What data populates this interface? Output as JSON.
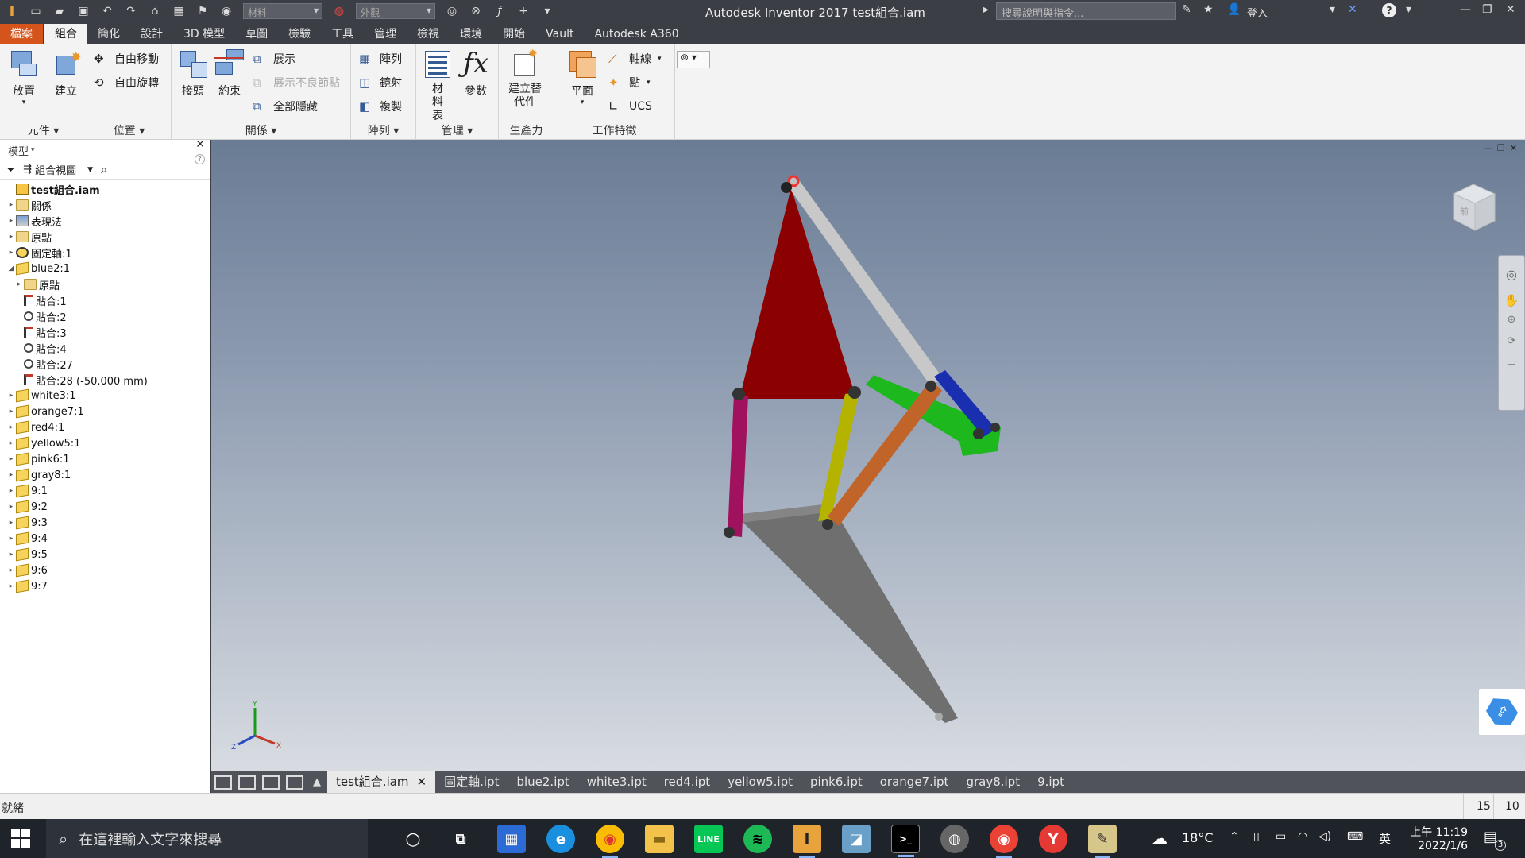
{
  "titlebar": {
    "app_title": "Autodesk Inventor 2017    test組合.iam",
    "material_placeholder": "材料",
    "appearance_placeholder": "外觀",
    "search_placeholder": "搜尋說明與指令...",
    "signin_label": "登入",
    "help_label": "?"
  },
  "ribbon_tabs": [
    {
      "label": "檔案"
    },
    {
      "label": "組合"
    },
    {
      "label": "簡化"
    },
    {
      "label": "設計"
    },
    {
      "label": "3D 模型"
    },
    {
      "label": "草圖"
    },
    {
      "label": "檢驗"
    },
    {
      "label": "工具"
    },
    {
      "label": "管理"
    },
    {
      "label": "檢視"
    },
    {
      "label": "環境"
    },
    {
      "label": "開始"
    },
    {
      "label": "Vault"
    },
    {
      "label": "Autodesk A360"
    }
  ],
  "ribbon": {
    "component": {
      "label": "元件",
      "place": "放置",
      "create": "建立"
    },
    "position": {
      "label": "位置",
      "free_move": "自由移動",
      "free_rotate": "自由旋轉"
    },
    "relationships": {
      "label": "關係",
      "joint": "接頭",
      "constrain": "約束",
      "show": "展示",
      "show_sick": "展示不良節點",
      "hide_all": "全部隱藏"
    },
    "pattern": {
      "label": "陣列",
      "pattern": "陣列",
      "mirror": "鏡射",
      "copy": "複製"
    },
    "manage": {
      "label": "管理",
      "bom": "材料表",
      "params": "參數"
    },
    "productivity": {
      "label": "生產力",
      "substitute": "建立替代件"
    },
    "work_features": {
      "label": "工作特徵",
      "plane": "平面",
      "axis": "軸線",
      "point": "點",
      "ucs": "UCS"
    }
  },
  "browser": {
    "title": "模型",
    "view_label": "組合視圖",
    "tree": [
      {
        "label": "test組合.iam",
        "icon": "asm",
        "indent": 0,
        "exp": "",
        "bold": true
      },
      {
        "label": "關係",
        "icon": "folder",
        "indent": 0,
        "exp": "▸"
      },
      {
        "label": "表現法",
        "icon": "rep",
        "indent": 0,
        "exp": "▸"
      },
      {
        "label": "原點",
        "icon": "folder",
        "indent": 0,
        "exp": "▸"
      },
      {
        "label": "固定軸:1",
        "icon": "fixed",
        "indent": 0,
        "exp": "▸"
      },
      {
        "label": "blue2:1",
        "icon": "part",
        "indent": 0,
        "exp": "◢"
      },
      {
        "label": "原點",
        "icon": "folder",
        "indent": 1,
        "exp": "▸"
      },
      {
        "label": "貼合:1",
        "icon": "mate",
        "indent": 1,
        "exp": ""
      },
      {
        "label": "貼合:2",
        "icon": "mate2",
        "indent": 1,
        "exp": ""
      },
      {
        "label": "貼合:3",
        "icon": "mate",
        "indent": 1,
        "exp": ""
      },
      {
        "label": "貼合:4",
        "icon": "mate2",
        "indent": 1,
        "exp": ""
      },
      {
        "label": "貼合:27",
        "icon": "mate2",
        "indent": 1,
        "exp": ""
      },
      {
        "label": "貼合:28 (-50.000 mm)",
        "icon": "mate",
        "indent": 1,
        "exp": ""
      },
      {
        "label": "white3:1",
        "icon": "part",
        "indent": 0,
        "exp": "▸"
      },
      {
        "label": "orange7:1",
        "icon": "part",
        "indent": 0,
        "exp": "▸"
      },
      {
        "label": "red4:1",
        "icon": "part",
        "indent": 0,
        "exp": "▸"
      },
      {
        "label": "yellow5:1",
        "icon": "part",
        "indent": 0,
        "exp": "▸"
      },
      {
        "label": "pink6:1",
        "icon": "part",
        "indent": 0,
        "exp": "▸"
      },
      {
        "label": "gray8:1",
        "icon": "part",
        "indent": 0,
        "exp": "▸"
      },
      {
        "label": "9:1",
        "icon": "part",
        "indent": 0,
        "exp": "▸"
      },
      {
        "label": "9:2",
        "icon": "part",
        "indent": 0,
        "exp": "▸"
      },
      {
        "label": "9:3",
        "icon": "part",
        "indent": 0,
        "exp": "▸"
      },
      {
        "label": "9:4",
        "icon": "part",
        "indent": 0,
        "exp": "▸"
      },
      {
        "label": "9:5",
        "icon": "part",
        "indent": 0,
        "exp": "▸"
      },
      {
        "label": "9:6",
        "icon": "part",
        "indent": 0,
        "exp": "▸"
      },
      {
        "label": "9:7",
        "icon": "part",
        "indent": 0,
        "exp": "▸"
      }
    ]
  },
  "viewport": {
    "viewcube_label": "前",
    "triad": {
      "x": "X",
      "y": "Y",
      "z": "Z"
    },
    "colors": {
      "red": "#8b0000",
      "white": "#c8c8c8",
      "blue": "#1a2fb0",
      "green": "#1db81d",
      "orange": "#c0642a",
      "yellow": "#b3b300",
      "pink": "#a0125e",
      "gray": "#6f6f6f"
    }
  },
  "doc_tabs": [
    {
      "label": "test組合.iam",
      "active": true
    },
    {
      "label": "固定軸.ipt"
    },
    {
      "label": "blue2.ipt"
    },
    {
      "label": "white3.ipt"
    },
    {
      "label": "red4.ipt"
    },
    {
      "label": "yellow5.ipt"
    },
    {
      "label": "pink6.ipt"
    },
    {
      "label": "orange7.ipt"
    },
    {
      "label": "gray8.ipt"
    },
    {
      "label": "9.ipt"
    }
  ],
  "status": {
    "text": "就緒",
    "count1": "15",
    "count2": "10"
  },
  "taskbar": {
    "search_placeholder": "在這裡輸入文字來搜尋",
    "weather": "18°C",
    "ime": "英",
    "time": "上午 11:19",
    "date": "2022/1/6",
    "notif_count": "3"
  }
}
